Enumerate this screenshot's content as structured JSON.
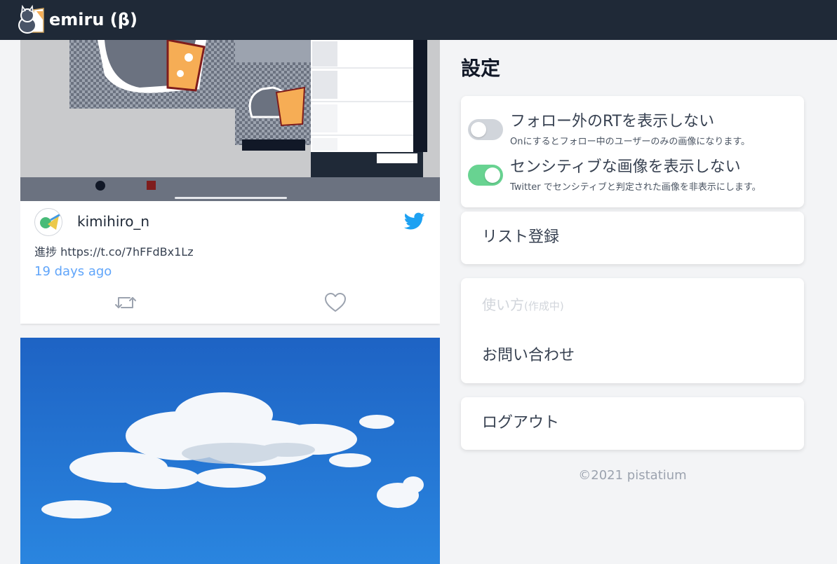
{
  "app": {
    "title": "emiru (β)"
  },
  "feed": {
    "tweets": [
      {
        "username": "kimihiro_n",
        "text": "進捗 https://t.co/7hFFdBx1Lz",
        "time": "19 days ago",
        "media": "drawing-app-screenshot"
      },
      {
        "media": "sky-clouds-painting"
      }
    ]
  },
  "settings": {
    "title": "設定",
    "toggles": [
      {
        "label": "フォロー外のRTを表示しない",
        "description": "Onにするとフォロー中のユーザーのみの画像になります。",
        "on": false
      },
      {
        "label": "センシティブな画像を表示しない",
        "description": "Twitter でセンシティブと判定された画像を非表示にします。",
        "on": true
      }
    ],
    "menu": {
      "list_register": "リスト登録",
      "usage": "使い方",
      "usage_note": "(作成中)",
      "contact": "お問い合わせ",
      "logout": "ログアウト"
    }
  },
  "colors": {
    "navbar": "#1f2937",
    "toggle_on": "#68d391",
    "toggle_off": "#d1d5db",
    "link": "#60a5fa",
    "twitter": "#1da1f2"
  },
  "footer": {
    "copyright": "©2021 pistatium"
  }
}
